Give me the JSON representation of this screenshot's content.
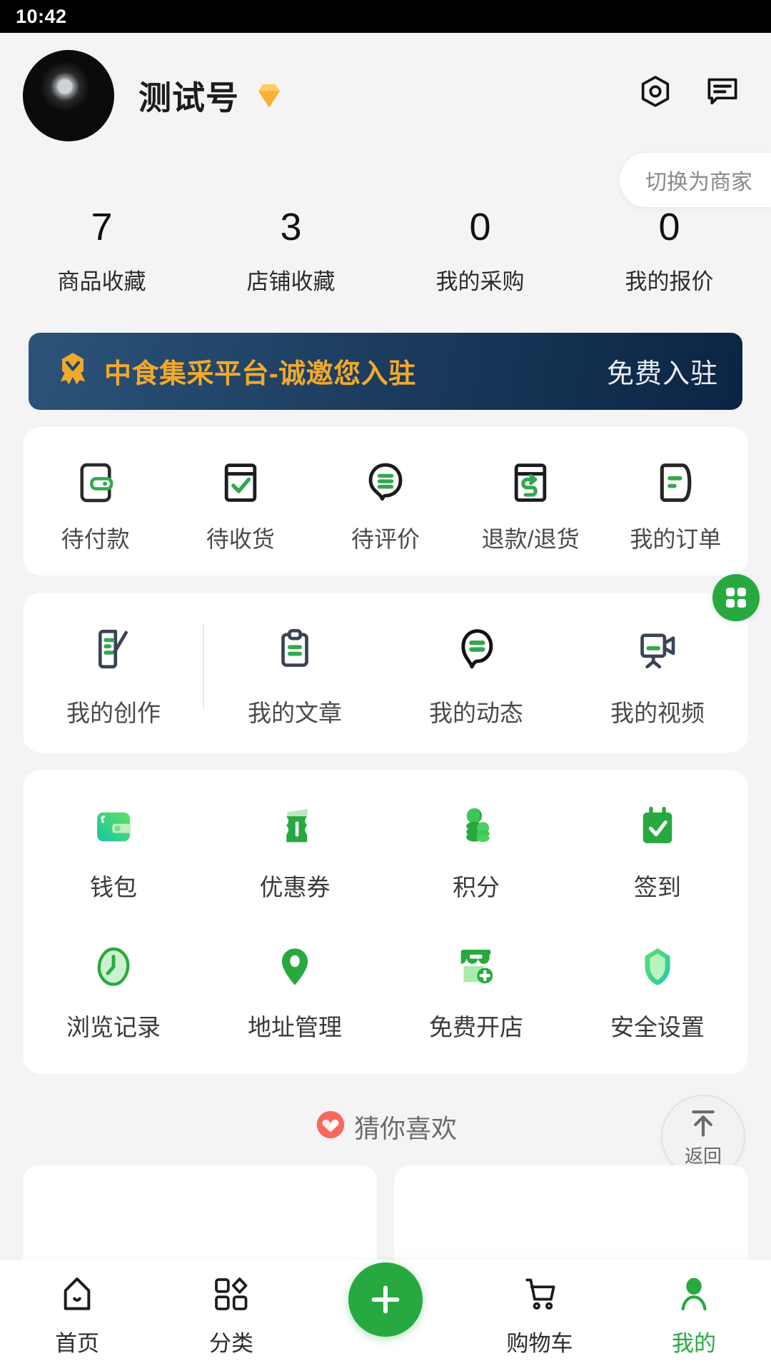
{
  "status_bar": {
    "time": "10:42"
  },
  "header": {
    "username": "测试号",
    "gem_icon": "diamond-badge-icon",
    "avatar_name": "user-avatar",
    "settings_icon": "hexagon-settings-icon",
    "message_icon": "chat-message-icon",
    "switch_merchant_label": "切换为商家"
  },
  "stats": [
    {
      "value": "7",
      "label": "商品收藏"
    },
    {
      "value": "3",
      "label": "店铺收藏"
    },
    {
      "value": "0",
      "label": "我的采购"
    },
    {
      "value": "0",
      "label": "我的报价"
    }
  ],
  "banner": {
    "icon": "gold-medal-icon",
    "title": "中食集采平台-诚邀您入驻",
    "cta": "免费入驻",
    "bg_start": "#2c5379",
    "bg_end": "#0b2443",
    "title_color": "#f0a92c",
    "cta_color": "#e9eaf2"
  },
  "orders": [
    {
      "label": "待付款",
      "icon": "wallet-pay-icon"
    },
    {
      "label": "待收货",
      "icon": "box-check-icon"
    },
    {
      "label": "待评价",
      "icon": "comment-review-icon"
    },
    {
      "label": "退款/退货",
      "icon": "box-return-icon"
    },
    {
      "label": "我的订单",
      "icon": "order-list-icon"
    }
  ],
  "creations": [
    {
      "label": "我的创作",
      "icon": "edit-document-icon"
    },
    {
      "label": "我的文章",
      "icon": "clipboard-article-icon"
    },
    {
      "label": "我的动态",
      "icon": "speech-bubble-icon"
    },
    {
      "label": "我的视频",
      "icon": "video-camera-icon"
    }
  ],
  "creation_fab_icon": "grid-apps-icon",
  "tools": [
    {
      "label": "钱包",
      "icon": "wallet-icon"
    },
    {
      "label": "优惠券",
      "icon": "coupon-ticket-icon"
    },
    {
      "label": "积分",
      "icon": "coin-stack-icon"
    },
    {
      "label": "签到",
      "icon": "calendar-check-icon"
    },
    {
      "label": "浏览记录",
      "icon": "clock-history-icon"
    },
    {
      "label": "地址管理",
      "icon": "location-pin-icon"
    },
    {
      "label": "免费开店",
      "icon": "shop-add-icon"
    },
    {
      "label": "安全设置",
      "icon": "shield-security-icon"
    }
  ],
  "recommend": {
    "title": "猜你喜欢",
    "icon": "heart-circle-icon",
    "icon_color": "#f8685c"
  },
  "back_to_top": {
    "label": "返回",
    "icon": "arrow-up-bar-icon"
  },
  "tabbar": [
    {
      "label": "首页",
      "icon": "home-icon",
      "active": false
    },
    {
      "label": "分类",
      "icon": "category-grid-icon",
      "active": false
    },
    {
      "label": "",
      "icon": "plus-fab-icon",
      "active": false
    },
    {
      "label": "购物车",
      "icon": "shopping-cart-icon",
      "active": false
    },
    {
      "label": "我的",
      "icon": "user-profile-icon",
      "active": true
    }
  ],
  "theme": {
    "primary": "#27a93f",
    "bg": "#f4f4f4",
    "card": "#ffffff"
  }
}
